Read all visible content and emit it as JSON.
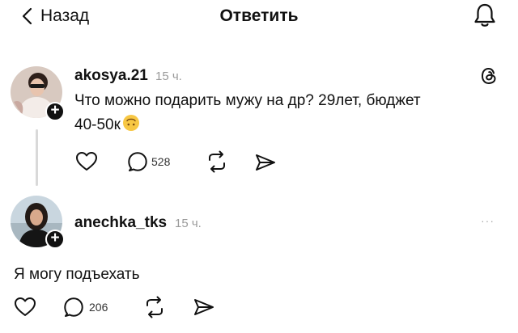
{
  "header": {
    "back_label": "Назад",
    "title": "Ответить"
  },
  "post": {
    "username": "akosya.21",
    "time": "15 ч.",
    "text_line1": "Что можно подарить мужу на др? 29лет, бюджет",
    "text_line2": "40-50к",
    "reply_count": "528"
  },
  "reply": {
    "username": "anechka_tks",
    "time": "15 ч.",
    "text": "Я могу подъехать",
    "reply_count": "206",
    "more": "···"
  },
  "icons": [
    "chevron-left-icon",
    "bell-icon",
    "threads-logo-icon",
    "heart-icon",
    "comment-icon",
    "repost-icon",
    "send-icon",
    "upside-down-face-emoji",
    "plus-icon"
  ],
  "colors": {
    "text": "#111111",
    "muted": "#9a9a9a",
    "thread_line": "#d9d9d9",
    "emoji": "#f7c744"
  }
}
